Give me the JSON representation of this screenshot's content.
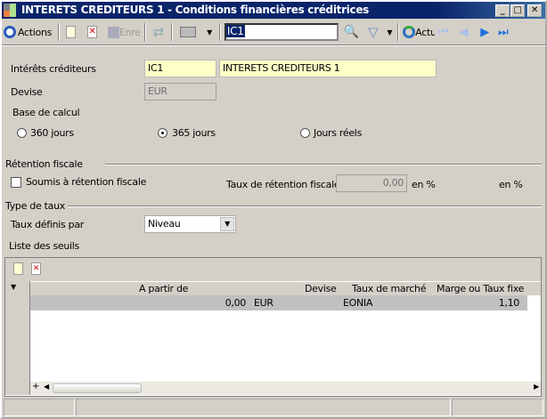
{
  "window": {
    "title": "INTERETS CREDITEURS 1 -  Conditions financières créditrices"
  },
  "toolbar": {
    "actions": "Actions",
    "save": "Enre",
    "search_value": "IC1",
    "refresh": "Actu"
  },
  "form": {
    "interets_label": "Intérêts créditeurs",
    "interets_code": "IC1",
    "interets_name": "INTERETS CREDITEURS 1",
    "devise_label": "Devise",
    "devise_value": "EUR",
    "base_label": "Base de calcul",
    "base_options": [
      {
        "label": "360 jours",
        "checked": false
      },
      {
        "label": "365 jours",
        "checked": true
      },
      {
        "label": "Jours réels",
        "checked": false
      }
    ],
    "retention_section": "Rétention fiscale",
    "retention_checkbox": "Soumis à rétention fiscale",
    "retention_checked": false,
    "taux_retention_label": "Taux de rétention fiscale",
    "taux_retention_value": "0,00",
    "unit1": "en %",
    "unit2": "en %",
    "type_section": "Type de taux",
    "taux_definis_label": "Taux définis par",
    "taux_definis_value": "Niveau",
    "seuils_label": "Liste des seuils"
  },
  "grid": {
    "columns": [
      "A partir de",
      "Devise",
      "Taux de marché",
      "Marge ou Taux fixe"
    ],
    "rows": [
      [
        "0,00",
        "EUR",
        "EONIA",
        "1,10"
      ]
    ],
    "add_symbol": "+"
  }
}
